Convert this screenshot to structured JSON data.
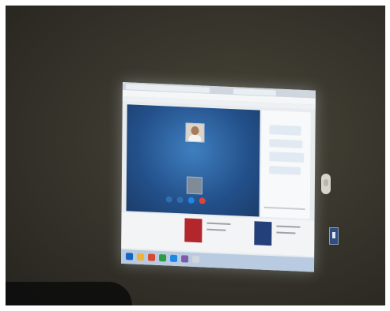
{
  "scene": {
    "description_tags": [
      "projected-screen",
      "video-call",
      "wall",
      "light-switch",
      "wall-socket"
    ],
    "colors": {
      "wall": "#3d3a31",
      "call_background": "#23508a",
      "hangup": "#d7473f",
      "accent": "#1e88e5",
      "taskbar": "#b8cbe0"
    }
  },
  "call": {
    "caller_name": "",
    "status": ""
  },
  "icons": {
    "mic": "mic-icon",
    "video": "video-icon",
    "hangup": "hangup-icon",
    "add": "add-participant-icon"
  }
}
